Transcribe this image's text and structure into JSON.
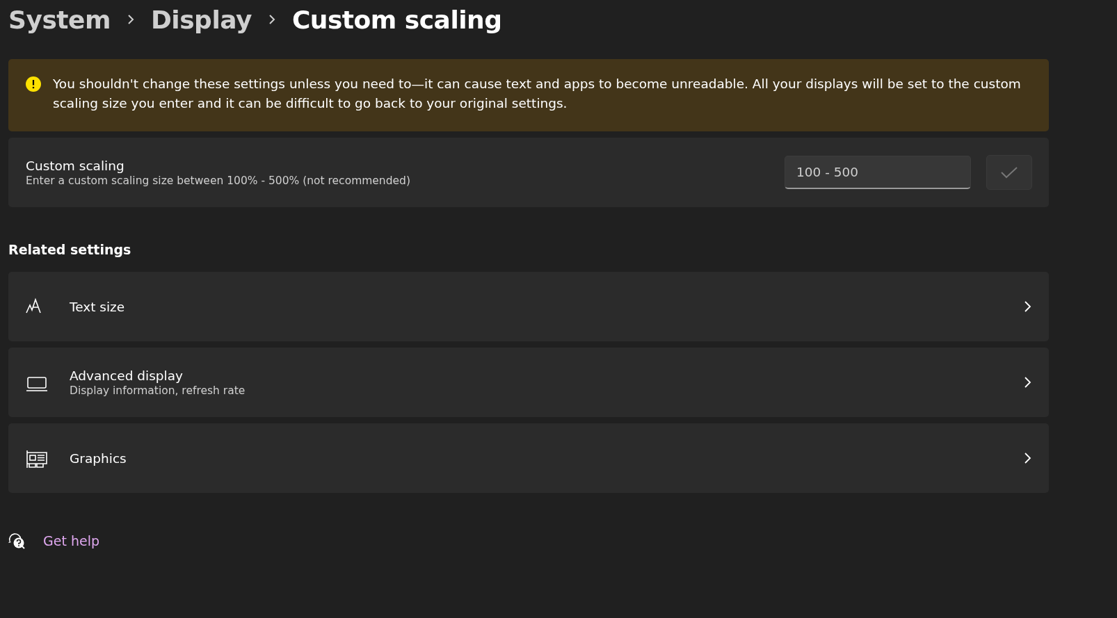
{
  "breadcrumb": [
    {
      "label": "System",
      "current": false
    },
    {
      "label": "Display",
      "current": false
    },
    {
      "label": "Custom scaling",
      "current": true
    }
  ],
  "warning": {
    "text": "You shouldn't change these settings unless you need to—it can cause text and apps to become unreadable. All your displays will be set to the custom scaling size you enter and it can be difficult to go back to your original settings."
  },
  "custom_scaling": {
    "title": "Custom scaling",
    "description": "Enter a custom scaling size between 100% - 500% (not recommended)",
    "input": {
      "placeholder": "100 - 500"
    },
    "apply_button": {
      "disabled": true
    }
  },
  "related_settings": {
    "heading": "Related settings",
    "items": [
      {
        "kind": "text-size",
        "title": "Text size"
      },
      {
        "kind": "display",
        "title": "Advanced display",
        "description": "Display information, refresh rate"
      },
      {
        "kind": "graphics",
        "title": "Graphics"
      }
    ]
  },
  "help_link": {
    "label": "Get help"
  }
}
